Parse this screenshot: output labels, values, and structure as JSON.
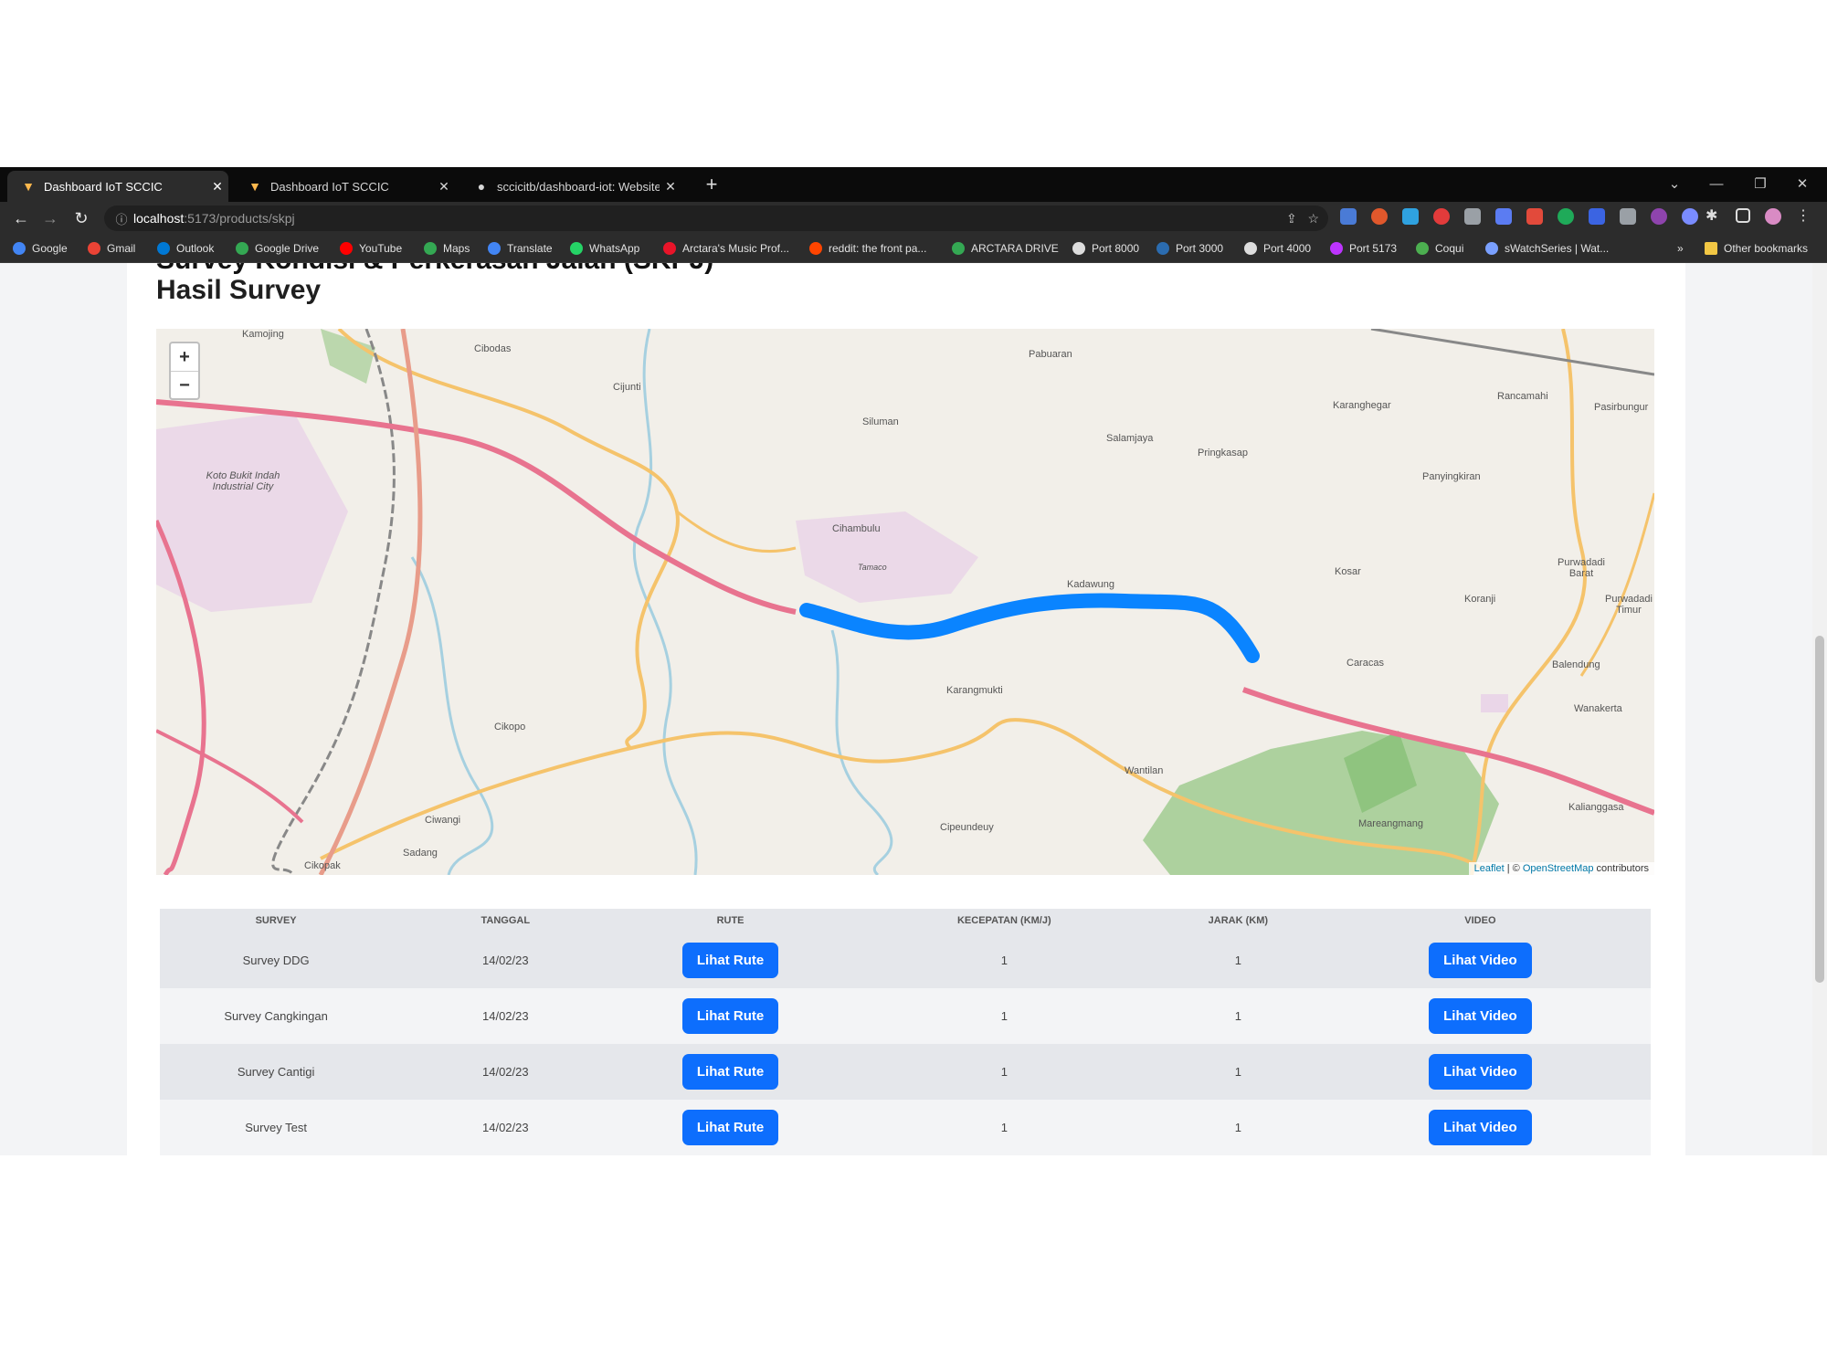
{
  "browser": {
    "tabs": [
      {
        "title": "Dashboard IoT SCCIC",
        "icon": "vite-icon",
        "active": true
      },
      {
        "title": "Dashboard IoT SCCIC",
        "icon": "vite-icon",
        "active": false
      },
      {
        "title": "sccicitb/dashboard-iot: Website",
        "icon": "github-icon",
        "active": false
      }
    ],
    "new_tab": "+",
    "address": {
      "host": "localhost",
      "path": ":5173/products/skpj"
    },
    "bookmarks": [
      {
        "label": "Google",
        "color": "#4285f4"
      },
      {
        "label": "Gmail",
        "color": "#ea4335"
      },
      {
        "label": "Outlook",
        "color": "#0078d4"
      },
      {
        "label": "Google Drive",
        "color": "#34a853"
      },
      {
        "label": "YouTube",
        "color": "#ff0000"
      },
      {
        "label": "Maps",
        "color": "#34a853"
      },
      {
        "label": "Translate",
        "color": "#4285f4"
      },
      {
        "label": "WhatsApp",
        "color": "#25d366"
      },
      {
        "label": "Arctara's Music Prof...",
        "color": "#e91429"
      },
      {
        "label": "reddit: the front pa...",
        "color": "#ff4500"
      },
      {
        "label": "ARCTARA DRIVE",
        "color": "#34a853"
      },
      {
        "label": "Port 8000",
        "color": "#dddddd"
      },
      {
        "label": "Port 3000",
        "color": "#2b6cb0"
      },
      {
        "label": "Port 4000",
        "color": "#dddddd"
      },
      {
        "label": "Port 5173",
        "color": "#bd34fe"
      },
      {
        "label": "Coqui",
        "color": "#4caf50"
      },
      {
        "label": "sWatchSeries | Wat...",
        "color": "#7aa0ff"
      }
    ],
    "more_bookmarks": "»",
    "other_bookmarks": "Other bookmarks"
  },
  "page": {
    "overflow_heading": "Survey Kondisi & Perkerasan Jalan (SKPJ)",
    "title": "Hasil Survey"
  },
  "map": {
    "zoom_in": "+",
    "zoom_out": "−",
    "attribution": {
      "leaflet": "Leaflet",
      "sep": " | © ",
      "osm": "OpenStreetMap",
      "contrib": " contributors"
    },
    "labels": [
      "Kamojing",
      "Cibodas",
      "Cijunti",
      "Pabuaran",
      "Siluman",
      "Salamjaya",
      "Pringkasap",
      "Karanghegar",
      "Rancamahi",
      "Pasirbungur",
      "Panyingkiran",
      "Koto Bukit Indah Industrial City",
      "Cihambulu",
      "Kadawung",
      "Kosar",
      "Koranji",
      "Purwadadi Barat",
      "Purwadadi Timur",
      "Caracas",
      "Balendung",
      "Wanakerta",
      "Karangmukti",
      "Cikopo",
      "Wantilan",
      "Ciwangi",
      "Sadang",
      "Cipeundeuy",
      "Cikopak",
      "Mareangmang",
      "Kalianggasa",
      "Tamaco",
      "Sadang"
    ],
    "route_color": "#0a84ff"
  },
  "table": {
    "headers": [
      "Survey",
      "Tanggal",
      "Rute",
      "Kecepatan (KM/J)",
      "Jarak (KM)",
      "Video"
    ],
    "rows": [
      {
        "survey": "Survey DDG",
        "tanggal": "14/02/23",
        "rute": "Lihat Rute",
        "kecepatan": "1",
        "jarak": "1",
        "video": "Lihat Video"
      },
      {
        "survey": "Survey Cangkingan",
        "tanggal": "14/02/23",
        "rute": "Lihat Rute",
        "kecepatan": "1",
        "jarak": "1",
        "video": "Lihat Video"
      },
      {
        "survey": "Survey Cantigi",
        "tanggal": "14/02/23",
        "rute": "Lihat Rute",
        "kecepatan": "1",
        "jarak": "1",
        "video": "Lihat Video"
      },
      {
        "survey": "Survey Test",
        "tanggal": "14/02/23",
        "rute": "Lihat Rute",
        "kecepatan": "1",
        "jarak": "1",
        "video": "Lihat Video"
      }
    ]
  },
  "colors": {
    "button": "#0d6efd",
    "row_alt": "#e5e7eb",
    "row_base": "#f3f4f6"
  }
}
